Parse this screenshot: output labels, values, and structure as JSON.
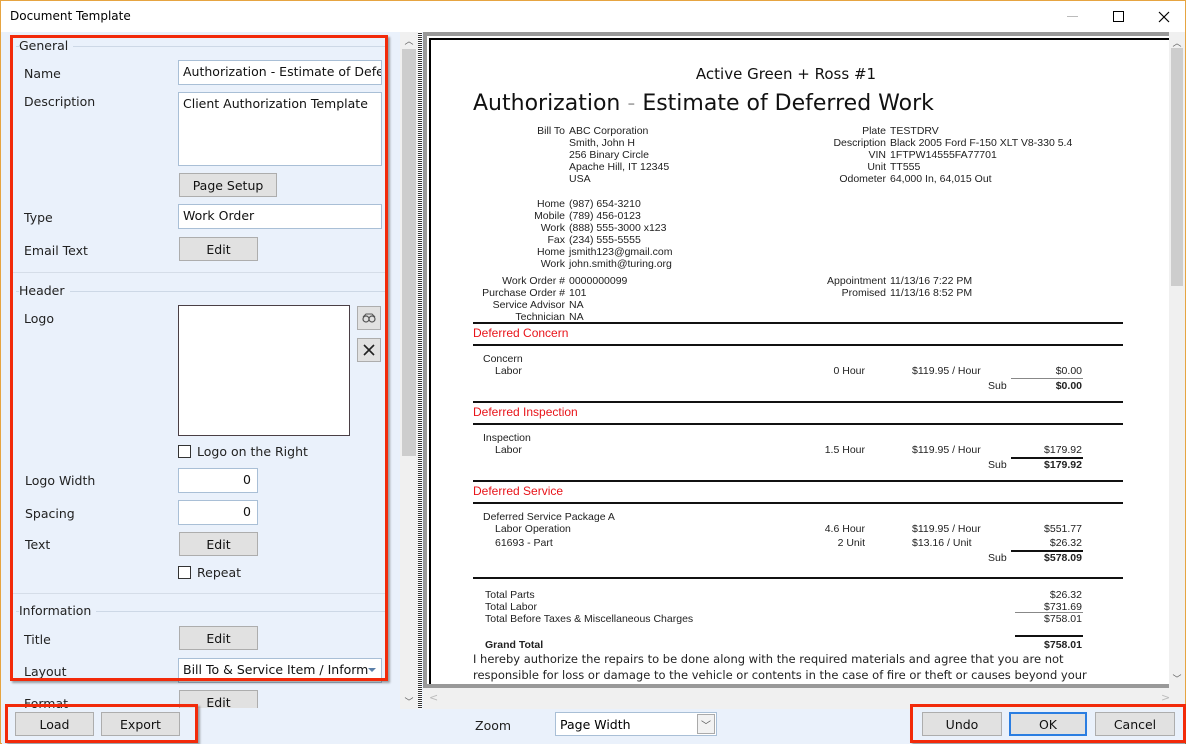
{
  "window": {
    "title": "Document Template",
    "controls": {
      "minimize": "—",
      "maximize": "☐",
      "close": "✕"
    }
  },
  "general": {
    "legend": "General",
    "name_label": "Name",
    "name_value": "Authorization - Estimate of Defer",
    "description_label": "Description",
    "description_value": "Client Authorization Template",
    "page_setup_button": "Page Setup",
    "type_label": "Type",
    "type_value": "Work Order",
    "email_text_label": "Email Text",
    "email_text_button": "Edit"
  },
  "header": {
    "legend": "Header",
    "logo_label": "Logo",
    "logo_on_right_label": "Logo on the Right",
    "logo_on_right_checked": false,
    "logo_width_label": "Logo Width",
    "logo_width_value": "0",
    "spacing_label": "Spacing",
    "spacing_value": "0",
    "text_label": "Text",
    "text_button": "Edit",
    "repeat_label": "Repeat",
    "repeat_checked": false
  },
  "information": {
    "legend": "Information",
    "title_label": "Title",
    "title_button": "Edit",
    "layout_label": "Layout",
    "layout_value": "Bill To & Service Item / Inform",
    "format_label": "Format",
    "format_button": "Edit"
  },
  "scroll": {
    "left_panel_position": 0,
    "preview_vertical_position": 0
  },
  "preview": {
    "shop_name": "Active Green + Ross #1",
    "title_part1": "Authorization",
    "title_dash": "-",
    "title_part2": "Estimate of Deferred Work",
    "bill_to_label": "Bill To",
    "bill_to_lines": [
      "ABC Corporation",
      "Smith, John H",
      "256 Binary Circle",
      "Apache Hill, IT 12345",
      "USA"
    ],
    "vehicle": [
      {
        "label": "Plate",
        "value": "TESTDRV"
      },
      {
        "label": "Description",
        "value": "Black 2005 Ford F-150 XLT V8-330 5.4"
      },
      {
        "label": "VIN",
        "value": "1FTPW14555FA77701"
      },
      {
        "label": "Unit",
        "value": "TT555"
      },
      {
        "label": "Odometer",
        "value": "64,000 In, 64,015 Out"
      }
    ],
    "contacts": [
      {
        "label": "Home",
        "value": "(987) 654-3210"
      },
      {
        "label": "Mobile",
        "value": "(789) 456-0123"
      },
      {
        "label": "Work",
        "value": "(888) 555-3000 x123"
      },
      {
        "label": "Fax",
        "value": "(234) 555-5555"
      },
      {
        "label": "Home",
        "value": "jsmith123@gmail.com"
      },
      {
        "label": "Work",
        "value": "john.smith@turing.org"
      }
    ],
    "order_info": [
      {
        "label": "Work Order #",
        "value": "0000000099"
      },
      {
        "label": "Purchase Order #",
        "value": "101"
      },
      {
        "label": "Service Advisor",
        "value": "NA"
      },
      {
        "label": "Technician",
        "value": "NA"
      }
    ],
    "schedule": [
      {
        "label": "Appointment",
        "value": "11/13/16 7:22 PM"
      },
      {
        "label": "Promised",
        "value": "11/13/16 8:52 PM"
      }
    ],
    "sections": [
      {
        "title": "Deferred Concern",
        "item": "Concern",
        "lines": [
          {
            "desc": "Labor",
            "qty": "0 Hour",
            "rate": "$119.95 / Hour",
            "amount": "$0.00"
          }
        ],
        "sub_label": "Sub",
        "sub_value": "$0.00"
      },
      {
        "title": "Deferred Inspection",
        "item": "Inspection",
        "lines": [
          {
            "desc": "Labor",
            "qty": "1.5 Hour",
            "rate": "$119.95 / Hour",
            "amount": "$179.92"
          }
        ],
        "sub_label": "Sub",
        "sub_value": "$179.92"
      },
      {
        "title": "Deferred Service",
        "item": "Deferred Service Package A",
        "lines": [
          {
            "desc": "Labor Operation",
            "qty": "4.6 Hour",
            "rate": "$119.95 / Hour",
            "amount": "$551.77"
          },
          {
            "desc": "61693 - Part",
            "qty": "2 Unit",
            "rate": "$13.16 / Unit",
            "amount": "$26.32"
          }
        ],
        "sub_label": "Sub",
        "sub_value": "$578.09"
      }
    ],
    "totals": [
      {
        "label": "Total Parts",
        "value": "$26.32"
      },
      {
        "label": "Total Labor",
        "value": "$731.69"
      },
      {
        "label": "Total Before Taxes & Miscellaneous Charges",
        "value": "$758.01"
      }
    ],
    "grand_total_label": "Grand Total",
    "grand_total_value": "$758.01",
    "authorization_text": "I hereby authorize the repairs to be done along with the required materials and agree that you are not responsible for loss or damage to the vehicle or contents in the case of fire or theft or causes beyond your control. I hereby grant you and your employees' permission to operate the vehicle on the streets and highways or elsewhere for the purpose of testing and or inspection. I acknowledge my"
  },
  "bottom": {
    "load_button": "Load",
    "export_button": "Export",
    "zoom_label": "Zoom",
    "zoom_value": "Page Width",
    "undo_button": "Undo",
    "ok_button": "OK",
    "cancel_button": "Cancel"
  },
  "colors": {
    "highlight_box": "#f22a0a",
    "section_title": "#e8141a",
    "panel_bg": "#eaf1fb",
    "ok_focus": "#2a7de1"
  }
}
